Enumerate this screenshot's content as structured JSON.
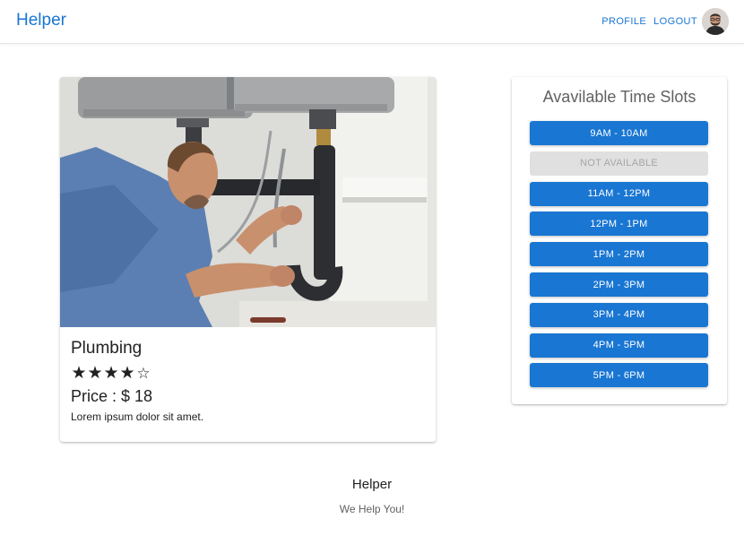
{
  "header": {
    "brand": "Helper",
    "nav": [
      {
        "label": "PROFILE"
      },
      {
        "label": "LOGOUT"
      }
    ]
  },
  "service": {
    "title": "Plumbing",
    "rating": 4,
    "rating_max": 5,
    "price_label": "Price : $",
    "price_value": "18",
    "description": "Lorem ipsum dolor sit amet."
  },
  "timeslots": {
    "title": "Avavilable Time Slots",
    "slots": [
      {
        "label": "9AM - 10AM",
        "available": true
      },
      {
        "label": "NOT AVAILABLE",
        "available": false
      },
      {
        "label": "11AM - 12PM",
        "available": true
      },
      {
        "label": "12PM - 1PM",
        "available": true
      },
      {
        "label": "1PM - 2PM",
        "available": true
      },
      {
        "label": "2PM - 3PM",
        "available": true
      },
      {
        "label": "3PM - 4PM",
        "available": true
      },
      {
        "label": "4PM - 5PM",
        "available": true
      },
      {
        "label": "5PM - 6PM",
        "available": true
      }
    ]
  },
  "footer": {
    "title": "Helper",
    "subtitle": "We Help You!"
  },
  "colors": {
    "primary": "#1976d2",
    "disabled_bg": "#e0e0e0",
    "disabled_text": "#a6a6a6"
  }
}
